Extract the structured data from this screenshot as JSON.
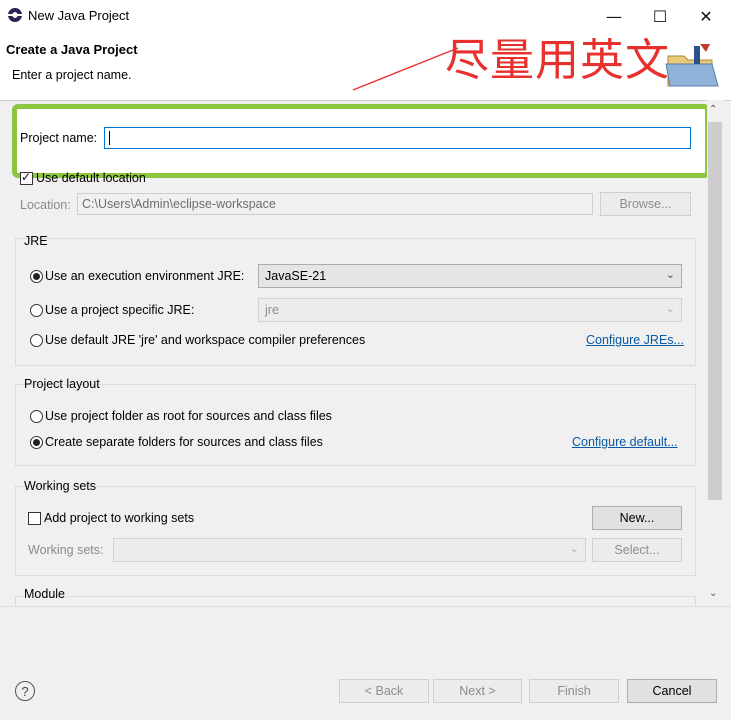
{
  "window": {
    "title": "New Java Project",
    "minimize": "—",
    "maximize": "☐",
    "close": "✕"
  },
  "header": {
    "title": "Create a Java Project",
    "description": "Enter a project name.",
    "annotation": "尽量用英文"
  },
  "form": {
    "project_name_label": "Project name:",
    "project_name_value": "",
    "use_default_location_label": "Use default location",
    "use_default_location_checked": true,
    "location_label": "Location:",
    "location_value": "C:\\Users\\Admin\\eclipse-workspace",
    "browse_label": "Browse..."
  },
  "jre": {
    "title": "JRE",
    "option_env_label": "Use an execution environment JRE:",
    "env_value": "JavaSE-21",
    "option_specific_label": "Use a project specific JRE:",
    "specific_value": "jre",
    "option_default_label": "Use default JRE 'jre' and workspace compiler preferences",
    "configure_link": "Configure JREs...",
    "selected": "env"
  },
  "layout": {
    "title": "Project layout",
    "option_root_label": "Use project folder as root for sources and class files",
    "option_separate_label": "Create separate folders for sources and class files",
    "configure_link": "Configure default...",
    "selected": "separate"
  },
  "working_sets": {
    "title": "Working sets",
    "add_label": "Add project to working sets",
    "new_label": "New...",
    "sets_label": "Working sets:",
    "sets_value": "",
    "select_label": "Select..."
  },
  "module": {
    "title": "Module"
  },
  "footer": {
    "help_icon": "?",
    "back_label": "< Back",
    "next_label": "Next >",
    "finish_label": "Finish",
    "cancel_label": "Cancel"
  },
  "colors": {
    "highlight_box": "#8cc63f",
    "annotation": "#e8302e",
    "link": "#0a5aa5",
    "focus_border": "#0078d7"
  }
}
